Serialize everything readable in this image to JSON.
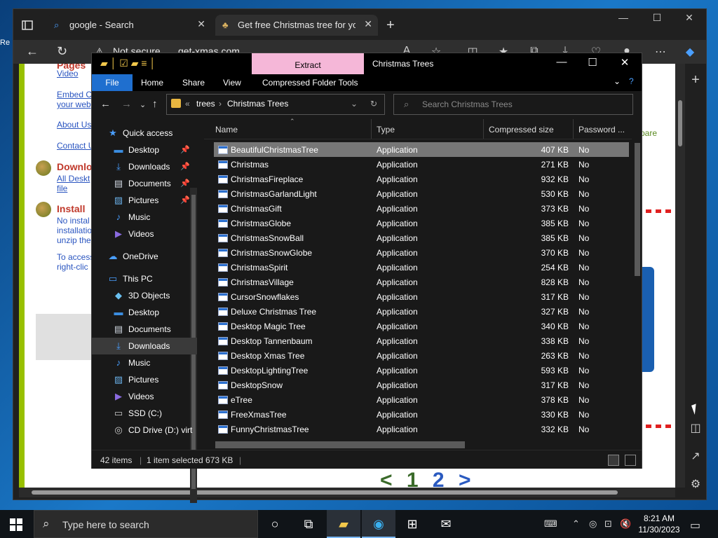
{
  "desktop": {
    "edge_text": "Re"
  },
  "browser": {
    "tabs": [
      {
        "label": "google - Search",
        "icon": "search-icon"
      },
      {
        "label": "Get free Christmas tree for your desktop",
        "icon": "tree-icon"
      }
    ],
    "address": {
      "security": "Not secure",
      "url": "get-xmas.com"
    },
    "webpage": {
      "top_partial": "Pages",
      "links": [
        "Video",
        "Embed C",
        "your web",
        "About Us",
        "Contact U"
      ],
      "head1": "Downlo",
      "link_all": "All Deskt",
      "link_file": "file",
      "head2": "Install",
      "install_text": [
        "No instal",
        "installatio",
        "unzip the"
      ],
      "access_text": [
        "To access",
        "right-clic"
      ],
      "spare": "spare",
      "pager": {
        "lt": "<",
        "p1": "1",
        "p2": "2",
        "gt": ">"
      }
    }
  },
  "explorer": {
    "title": "Christmas Trees",
    "extract_tab": "Extract",
    "ribbon_tabs": [
      "File",
      "Home",
      "Share",
      "View",
      "Compressed Folder Tools"
    ],
    "breadcrumb": {
      "sep": "«",
      "parent": "trees",
      "current": "Christmas Trees"
    },
    "search_placeholder": "Search Christmas Trees",
    "nav": [
      {
        "label": "Quick access",
        "icon": "star-icon"
      },
      {
        "label": "Desktop",
        "icon": "desktop-icon",
        "pinned": true
      },
      {
        "label": "Downloads",
        "icon": "download-icon",
        "pinned": true
      },
      {
        "label": "Documents",
        "icon": "documents-icon",
        "pinned": true
      },
      {
        "label": "Pictures",
        "icon": "pictures-icon",
        "pinned": true
      },
      {
        "label": "Music",
        "icon": "music-icon"
      },
      {
        "label": "Videos",
        "icon": "videos-icon"
      },
      {
        "label": "OneDrive",
        "icon": "cloud-icon"
      },
      {
        "label": "This PC",
        "icon": "pc-icon"
      },
      {
        "label": "3D Objects",
        "icon": "cube-icon"
      },
      {
        "label": "Desktop",
        "icon": "desktop-icon"
      },
      {
        "label": "Documents",
        "icon": "documents-icon"
      },
      {
        "label": "Downloads",
        "icon": "download-icon",
        "selected": true
      },
      {
        "label": "Music",
        "icon": "music-icon"
      },
      {
        "label": "Pictures",
        "icon": "pictures-icon"
      },
      {
        "label": "Videos",
        "icon": "videos-icon"
      },
      {
        "label": "SSD (C:)",
        "icon": "drive-icon"
      },
      {
        "label": "CD Drive (D:) virt",
        "icon": "cd-drive-icon"
      }
    ],
    "columns": [
      "Name",
      "Type",
      "Compressed size",
      "Password ..."
    ],
    "files": [
      {
        "name": "BeautifulChristmasTree",
        "type": "Application",
        "size": "407 KB",
        "pw": "No"
      },
      {
        "name": "Christmas",
        "type": "Application",
        "size": "271 KB",
        "pw": "No"
      },
      {
        "name": "ChristmasFireplace",
        "type": "Application",
        "size": "932 KB",
        "pw": "No"
      },
      {
        "name": "ChristmasGarlandLight",
        "type": "Application",
        "size": "530 KB",
        "pw": "No"
      },
      {
        "name": "ChristmasGift",
        "type": "Application",
        "size": "373 KB",
        "pw": "No"
      },
      {
        "name": "ChristmasGlobe",
        "type": "Application",
        "size": "385 KB",
        "pw": "No"
      },
      {
        "name": "ChristmasSnowBall",
        "type": "Application",
        "size": "385 KB",
        "pw": "No"
      },
      {
        "name": "ChristmasSnowGlobe",
        "type": "Application",
        "size": "370 KB",
        "pw": "No"
      },
      {
        "name": "ChristmasSpirit",
        "type": "Application",
        "size": "254 KB",
        "pw": "No"
      },
      {
        "name": "ChristmasVillage",
        "type": "Application",
        "size": "828 KB",
        "pw": "No"
      },
      {
        "name": "CursorSnowflakes",
        "type": "Application",
        "size": "317 KB",
        "pw": "No"
      },
      {
        "name": "Deluxe Christmas Tree",
        "type": "Application",
        "size": "327 KB",
        "pw": "No"
      },
      {
        "name": "Desktop Magic Tree",
        "type": "Application",
        "size": "340 KB",
        "pw": "No"
      },
      {
        "name": "Desktop Tannenbaum",
        "type": "Application",
        "size": "338 KB",
        "pw": "No"
      },
      {
        "name": "Desktop Xmas Tree",
        "type": "Application",
        "size": "263 KB",
        "pw": "No"
      },
      {
        "name": "DesktopLightingTree",
        "type": "Application",
        "size": "593 KB",
        "pw": "No"
      },
      {
        "name": "DesktopSnow",
        "type": "Application",
        "size": "317 KB",
        "pw": "No"
      },
      {
        "name": "eTree",
        "type": "Application",
        "size": "378 KB",
        "pw": "No"
      },
      {
        "name": "FreeXmasTree",
        "type": "Application",
        "size": "330 KB",
        "pw": "No"
      },
      {
        "name": "FunnyChristmasTree",
        "type": "Application",
        "size": "332 KB",
        "pw": "No"
      }
    ],
    "status": {
      "items": "42 items",
      "selected": "1 item selected  673 KB"
    }
  },
  "taskbar": {
    "search_placeholder": "Type here to search",
    "time": "8:21 AM",
    "date": "11/30/2023"
  }
}
